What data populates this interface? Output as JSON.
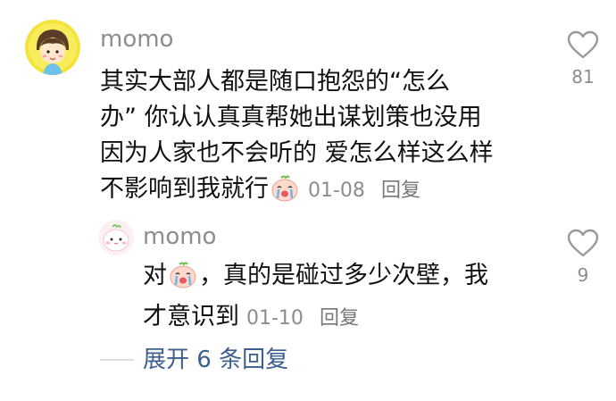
{
  "comment": {
    "username": "momo",
    "text_lines": [
      "其实大部人都是随口抱怨的“怎么",
      "办” 你认认真真帮她出谋划策也没用",
      "因为人家也不会听的 爱怎么样这么样",
      "不影响到我就行"
    ],
    "emoji": "crying-face-emoji",
    "date": "01-08",
    "reply_label": "回复",
    "like_count": "81"
  },
  "reply": {
    "username": "momo",
    "text_prefix": "对",
    "text_line1_rest": "，真的是碰过多少次壁，我",
    "text_line2": "才意识到",
    "emoji": "crying-face-emoji",
    "date": "01-10",
    "reply_label": "回复",
    "like_count": "9"
  },
  "expand": {
    "label": "展开 6 条回复"
  },
  "colors": {
    "text": "#111111",
    "meta": "#8d8d8d",
    "link": "#3c5f8e"
  }
}
